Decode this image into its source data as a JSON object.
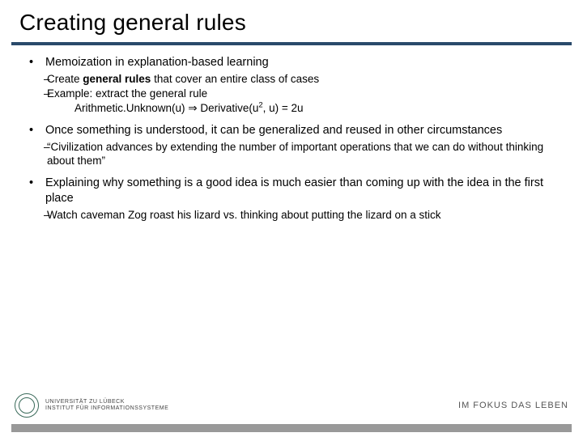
{
  "title": "Creating general rules",
  "bullets": [
    {
      "text": "Memoization in explanation-based learning",
      "sub": [
        {
          "text_html": "Create <b>general rules</b> that cover an entire class of cases"
        },
        {
          "text": "Example: extract the general rule",
          "sub_line_html": "Arithmetic.Unknown(u) ⇒ Derivative(u<sup>2</sup>, u) = 2u"
        }
      ]
    },
    {
      "text": "Once something is understood, it can be generalized and reused in other circumstances",
      "sub": [
        {
          "text": "“Civilization advances by extending the number of important operations that we can do without thinking about them”"
        }
      ]
    },
    {
      "text": "Explaining why something is a good idea is much easier than coming up with the idea in the first place",
      "sub": [
        {
          "text": "Watch caveman Zog roast his lizard vs. thinking about putting the lizard on a stick"
        }
      ]
    }
  ],
  "footer": {
    "uni_line1": "UNIVERSITÄT ZU LÜBECK",
    "uni_line2": "INSTITUT FÜR INFORMATIONSSYSTEME",
    "tagline": "IM FOKUS DAS LEBEN"
  }
}
